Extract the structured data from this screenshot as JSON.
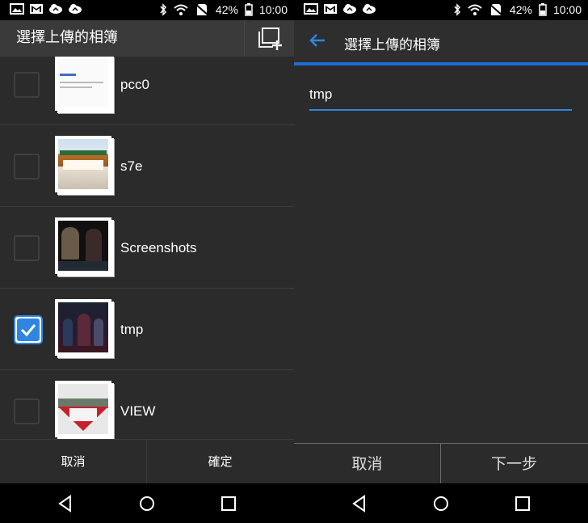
{
  "status": {
    "battery": "42%",
    "time": "10:00"
  },
  "left": {
    "title": "選擇上傳的相簿",
    "albums": [
      {
        "name": "pcc0",
        "checked": false
      },
      {
        "name": "s7e",
        "checked": false
      },
      {
        "name": "Screenshots",
        "checked": false
      },
      {
        "name": "tmp",
        "checked": true
      },
      {
        "name": "VIEW",
        "checked": false
      }
    ],
    "cancel_label": "取消",
    "confirm_label": "確定"
  },
  "right": {
    "title": "選擇上傳的相簿",
    "album_name_value": "tmp",
    "cancel_label": "取消",
    "next_label": "下一步"
  },
  "colors": {
    "accent": "#2f86e0",
    "bar_blue": "#1e6fd1",
    "background": "#2b2b2b"
  }
}
